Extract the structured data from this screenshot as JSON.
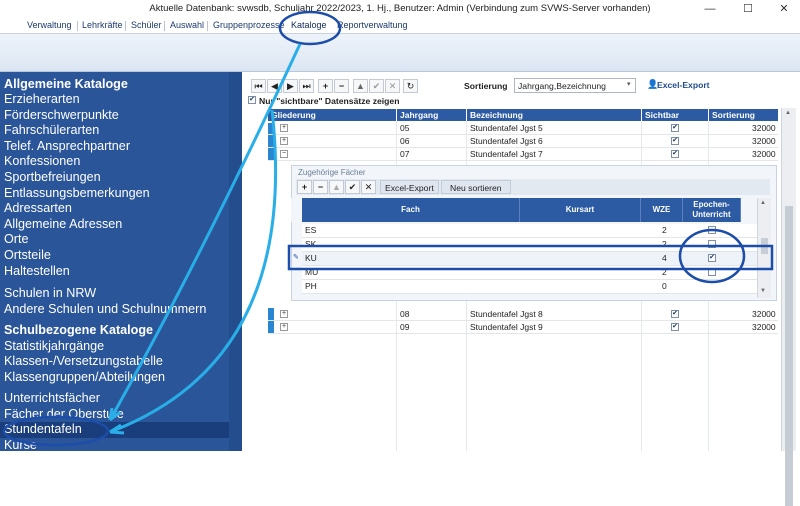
{
  "window": {
    "title": "Aktuelle Datenbank: svwsdb, Schuljahr 2022/2023, 1. Hj., Benutzer: Admin (Verbindung zum SVWS-Server vorhanden)",
    "min": "—",
    "max": "☐",
    "close": "✕"
  },
  "menu": [
    "Verwaltung",
    "Lehrkräfte",
    "Schüler",
    "Auswahl",
    "Gruppenprozesse",
    "Kataloge",
    "Reportverwaltung"
  ],
  "sidebar": {
    "section1_title": "Allgemeine Kataloge",
    "section1_items": [
      "Erzieherarten",
      "Förderschwerpunkte",
      "Fahrschülerarten",
      "Telef. Ansprechpartner",
      "Konfessionen",
      "Sportbefreiungen",
      "Entlassungsbemerkungen",
      "Adressarten",
      "Allgemeine Adressen",
      "Orte",
      "Ortsteile",
      "Haltestellen"
    ],
    "section2_items": [
      "Schulen in NRW",
      "Andere Schulen und Schulnummern"
    ],
    "section3_title": "Schulbezogene Kataloge",
    "section3_items": [
      "Statistikjahrgänge",
      "Klassen-/Versetzungstabelle",
      "Klassengruppen/Abteilungen"
    ],
    "section4_items": [
      "Unterrichtsfächer",
      "Fächer der Oberstufe",
      "Stundentafeln",
      "Kurse"
    ]
  },
  "toolbar": {
    "buttons": [
      "⏮",
      "◀",
      "▶",
      "⏭",
      "+",
      "−",
      "▲",
      "✔",
      "✕",
      "↻"
    ],
    "sort_label": "Sortierung",
    "sort_value": "Jahrgang,Bezeichnung",
    "excel_label": "Excel-Export",
    "filter_label": "Nur \"sichtbare\" Datensätze zeigen"
  },
  "grid": {
    "columns": [
      "Gliederung",
      "Jahrgang",
      "Bezeichnung",
      "Sichtbar",
      "Sortierung"
    ],
    "rows_top": [
      {
        "jahrgang": "05",
        "bezeichnung": "Stundentafel Jgst 5",
        "sichtbar": true,
        "sortierung": "32000",
        "expand": "+"
      },
      {
        "jahrgang": "06",
        "bezeichnung": "Stundentafel Jgst 6",
        "sichtbar": true,
        "sortierung": "32000",
        "expand": "+"
      },
      {
        "jahrgang": "07",
        "bezeichnung": "Stundentafel Jgst 7",
        "sichtbar": true,
        "sortierung": "32000",
        "expand": "−"
      }
    ],
    "rows_bottom": [
      {
        "jahrgang": "08",
        "bezeichnung": "Stundentafel Jgst 8",
        "sichtbar": true,
        "sortierung": "32000",
        "expand": "+"
      },
      {
        "jahrgang": "09",
        "bezeichnung": "Stundentafel Jgst 9",
        "sichtbar": true,
        "sortierung": "32000",
        "expand": "+"
      }
    ]
  },
  "detail": {
    "title": "Zugehörige Fächer",
    "buttons": [
      "+",
      "−",
      "▲",
      "✔",
      "✕"
    ],
    "excel_label": "Excel-Export",
    "resort_label": "Neu sortieren",
    "columns": [
      "Fach",
      "Kursart",
      "WZE",
      "Epochen-\nUnterricht"
    ],
    "rows": [
      {
        "fach": "ES",
        "wze": "2",
        "epochen": false
      },
      {
        "fach": "SK",
        "wze": "2",
        "epochen": false
      },
      {
        "fach": "KU",
        "wze": "4",
        "epochen": true
      },
      {
        "fach": "MU",
        "wze": "2",
        "epochen": false
      },
      {
        "fach": "PH",
        "wze": "0",
        "epochen": false
      }
    ]
  },
  "colors": {
    "sidebar": "#2a5599",
    "header": "#2c5ba3",
    "annotation": "#1f88d6",
    "annotation_box": "#1c4da8"
  }
}
